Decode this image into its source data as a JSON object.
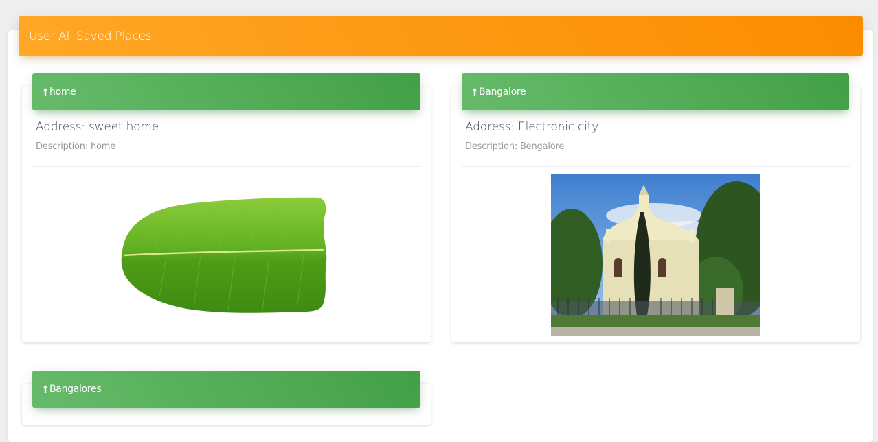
{
  "page": {
    "title": "User All Saved Places"
  },
  "places": [
    {
      "name": "home",
      "address": "Address: sweet home",
      "description": "Description: home",
      "image_icon": "banana-leaf-image"
    },
    {
      "name": "Bangalore",
      "address": "Address: Electronic city",
      "description": "Description: Bengalore",
      "image_icon": "church-photo"
    },
    {
      "name": "Bangalores"
    }
  ],
  "colors": {
    "header_accent": "#fb8c00",
    "place_header_accent": "#43a047",
    "background": "#eeeeee"
  }
}
